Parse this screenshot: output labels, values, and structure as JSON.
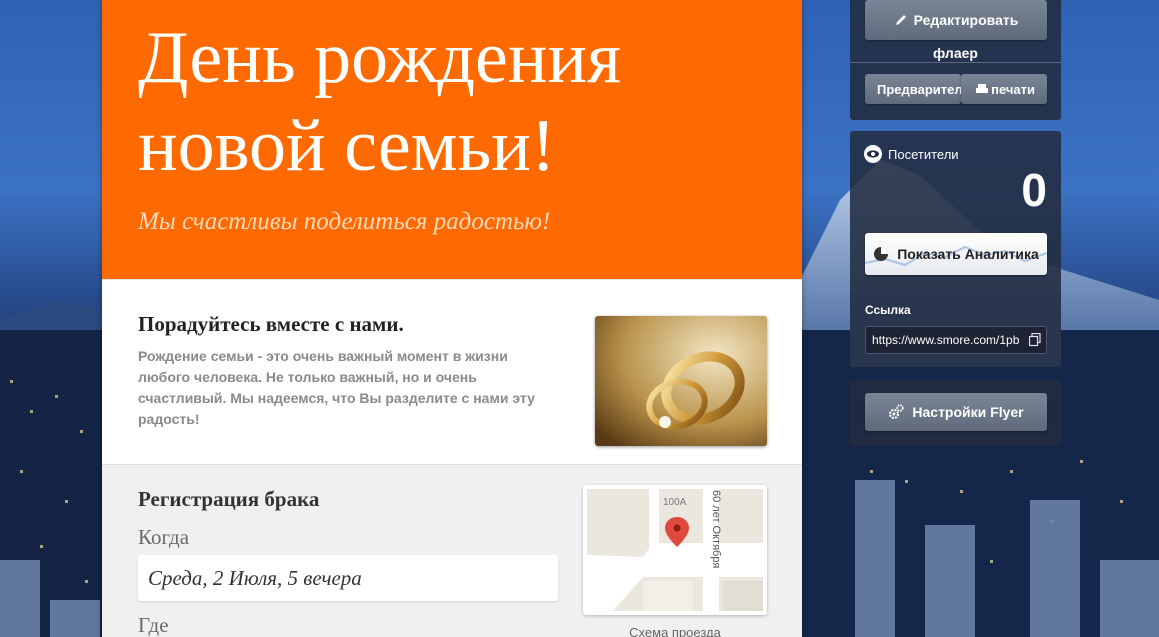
{
  "flyer": {
    "header": {
      "title": "День рождения новой семьи!",
      "subtitle": "Мы счастливы поделиться радостью!",
      "bg_color": "#ff6a00"
    },
    "intro": {
      "heading": "Порадуйтесь вместе с нами.",
      "body": "Рождение семьи - это очень важный момент в жизни любого человека. Не только важный, но и очень счастливый. Мы надеемся, что Вы разделите с нами эту радость!",
      "photo_icon": "wedding-rings-photo"
    },
    "event": {
      "heading": "Регистрация брака",
      "when_label": "Когда",
      "when_value": "Среда, 2 Июля, 5 вечера",
      "where_label": "Где",
      "map": {
        "house_number": "100А",
        "street": "60 лет Октября",
        "pin_icon": "map-pin-icon"
      },
      "map_caption": "Схема проезда"
    }
  },
  "panel": {
    "edit_label": "Редактировать",
    "flaer_label": "флаер",
    "preview_label": "Предварительный",
    "print_label": "печати",
    "visitors_label": "Посетители",
    "visitors_count": "0",
    "analytics_label": "Показать Аналитика",
    "link_label": "Ссылка",
    "link_value": "https://www.smore.com/1pb",
    "settings_label": "Настройки Flyer"
  }
}
